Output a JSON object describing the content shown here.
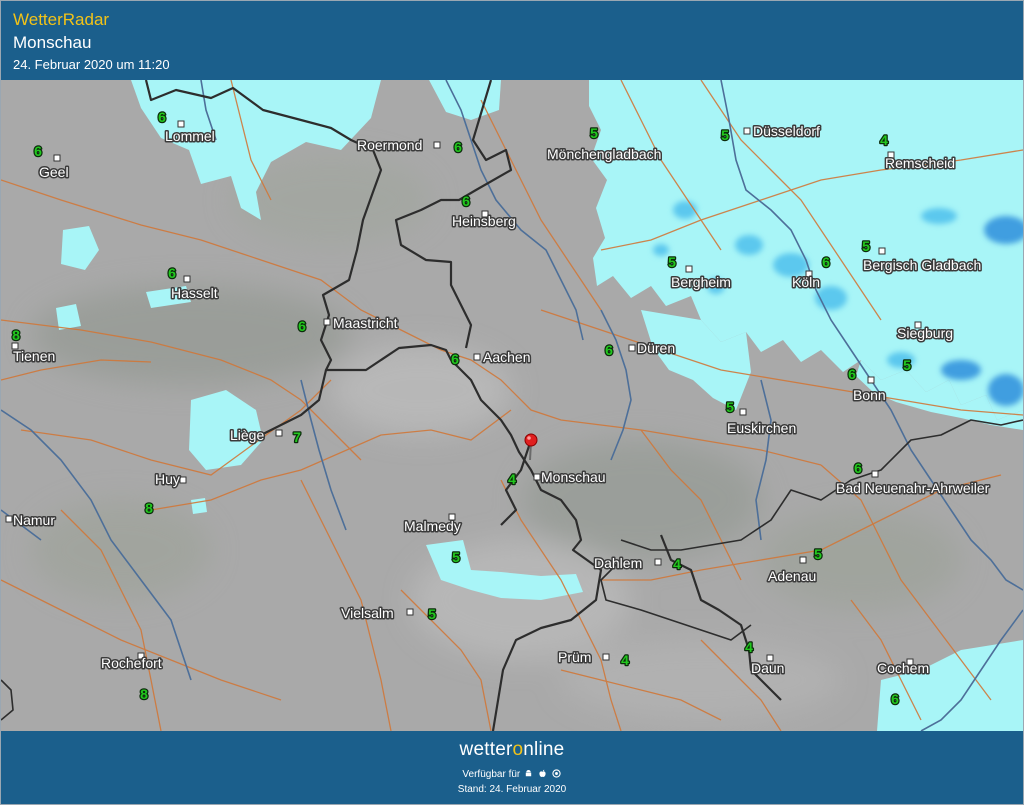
{
  "header": {
    "brand": "WetterRadar",
    "place": "Monschau",
    "date": "24. Februar 2020 um 11:20"
  },
  "colors": {
    "header_bg": "#1b5f8c",
    "brand_yellow": "#f2c318",
    "map_gray": "#a9a9a9",
    "precip_light": "#a8f5f7",
    "precip_medium": "#5cc8ee",
    "precip_strong": "#2f8fd6",
    "forecast_value": "#22c81e",
    "river": "#4d6f99",
    "border": "#2d2d2d",
    "road": "#d0783a",
    "marker": "#e02020"
  },
  "map": {
    "marker": {
      "name": "Monschau",
      "icon": "location-pin-icon"
    },
    "cities": [
      {
        "id": "lommel",
        "name": "Lommel"
      },
      {
        "id": "roermond",
        "name": "Roermond"
      },
      {
        "id": "moenchengladbach",
        "name": "Mönchengladbach"
      },
      {
        "id": "duesseldorf",
        "name": "Düsseldorf"
      },
      {
        "id": "geel",
        "name": "Geel"
      },
      {
        "id": "remscheid",
        "name": "Remscheid"
      },
      {
        "id": "heinsberg",
        "name": "Heinsberg"
      },
      {
        "id": "hasselt",
        "name": "Hasselt"
      },
      {
        "id": "bergheim",
        "name": "Bergheim"
      },
      {
        "id": "koeln",
        "name": "Köln"
      },
      {
        "id": "bergisch-gladbach",
        "name": "Bergisch Gladbach"
      },
      {
        "id": "maastricht",
        "name": "Maastricht"
      },
      {
        "id": "tienen",
        "name": "Tienen"
      },
      {
        "id": "aachen",
        "name": "Aachen"
      },
      {
        "id": "dueren",
        "name": "Düren"
      },
      {
        "id": "siegburg",
        "name": "Siegburg"
      },
      {
        "id": "bonn",
        "name": "Bonn"
      },
      {
        "id": "euskirchen",
        "name": "Euskirchen"
      },
      {
        "id": "liege",
        "name": "Liège"
      },
      {
        "id": "huy",
        "name": "Huy"
      },
      {
        "id": "monschau",
        "name": "Monschau"
      },
      {
        "id": "bad-neuenahr-ahrweiler",
        "name": "Bad Neuenahr-Ahrweiler"
      },
      {
        "id": "namur",
        "name": "Namur"
      },
      {
        "id": "malmedy",
        "name": "Malmedy"
      },
      {
        "id": "dahlem",
        "name": "Dahlem"
      },
      {
        "id": "adenau",
        "name": "Adenau"
      },
      {
        "id": "vielsalm",
        "name": "Vielsalm"
      },
      {
        "id": "pruem",
        "name": "Prüm"
      },
      {
        "id": "rochefort",
        "name": "Rochefort"
      },
      {
        "id": "daun",
        "name": "Daun"
      },
      {
        "id": "cochem",
        "name": "Cochem"
      }
    ],
    "values": [
      {
        "id": "lommel",
        "value": "6"
      },
      {
        "id": "roermond",
        "value": "6"
      },
      {
        "id": "moenchengladbach",
        "value": "5"
      },
      {
        "id": "duesseldorf",
        "value": "5"
      },
      {
        "id": "geel",
        "value": "6"
      },
      {
        "id": "remscheid",
        "value": "4"
      },
      {
        "id": "heinsberg",
        "value": "6"
      },
      {
        "id": "hasselt",
        "value": "6"
      },
      {
        "id": "bergheim",
        "value": "5"
      },
      {
        "id": "koeln",
        "value": "6"
      },
      {
        "id": "bergisch-gladbach",
        "value": "5"
      },
      {
        "id": "maastricht",
        "value": "6"
      },
      {
        "id": "tienen",
        "value": "8"
      },
      {
        "id": "aachen",
        "value": "6"
      },
      {
        "id": "dueren",
        "value": "6"
      },
      {
        "id": "siegburg",
        "value": "5"
      },
      {
        "id": "bonn",
        "value": "6"
      },
      {
        "id": "euskirchen",
        "value": "5"
      },
      {
        "id": "liege",
        "value": "7"
      },
      {
        "id": "huy",
        "value": "8"
      },
      {
        "id": "monschau",
        "value": "4"
      },
      {
        "id": "bad-neuenahr-ahrweiler",
        "value": "6"
      },
      {
        "id": "malmedy",
        "value": "5"
      },
      {
        "id": "dahlem",
        "value": "4"
      },
      {
        "id": "adenau",
        "value": "5"
      },
      {
        "id": "vielsalm",
        "value": "5"
      },
      {
        "id": "pruem",
        "value": "4"
      },
      {
        "id": "rochefort",
        "value": "8"
      },
      {
        "id": "daun",
        "value": "4"
      },
      {
        "id": "cochem",
        "value": "6"
      }
    ]
  },
  "footer": {
    "logo_left": "wetter",
    "logo_o": "o",
    "logo_right": "nline",
    "available": "Verfügbar für",
    "platforms": [
      "android-icon",
      "apple-icon",
      "windows-icon"
    ],
    "stand": "Stand: 24. Februar 2020"
  }
}
